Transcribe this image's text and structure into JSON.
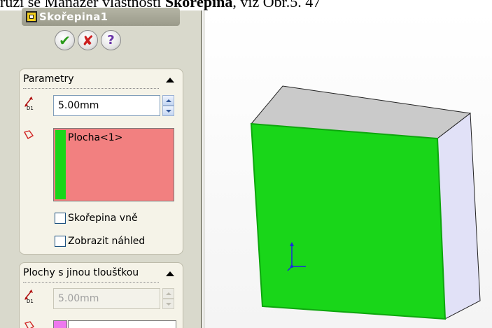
{
  "document": {
    "line_prefix": "ruží se Manažer vlastností ",
    "line_bold": "Skořepina",
    "line_suffix": ", viz Obr.5. 47"
  },
  "property_manager": {
    "title": "Skořepina1",
    "actions": {
      "ok": "✔",
      "cancel": "✘",
      "help": "?"
    },
    "parameters": {
      "header": "Parametry",
      "thickness_value": "5.00mm",
      "faces_to_remove": [
        "Plocha<1>"
      ],
      "shell_outward_label": "Skořepina vně",
      "shell_outward_checked": false,
      "show_preview_label": "Zobrazit náhled",
      "show_preview_checked": false
    },
    "multi_thickness": {
      "header": "Plochy s jinou tloušťkou",
      "thickness_value": "5.00mm"
    }
  },
  "icons": {
    "title": "shell-feature-icon",
    "thickness": "dimension-arrow-icon",
    "faces": "face-selection-icon"
  },
  "colors": {
    "selected_face": "#19d619",
    "face_list_bg": "#f28080",
    "side_face": "#e1e1f7",
    "top_face": "#cacaca",
    "multi_face_swatch": "#ee78ee"
  },
  "viewport": {
    "model": "box-with-selected-face"
  }
}
